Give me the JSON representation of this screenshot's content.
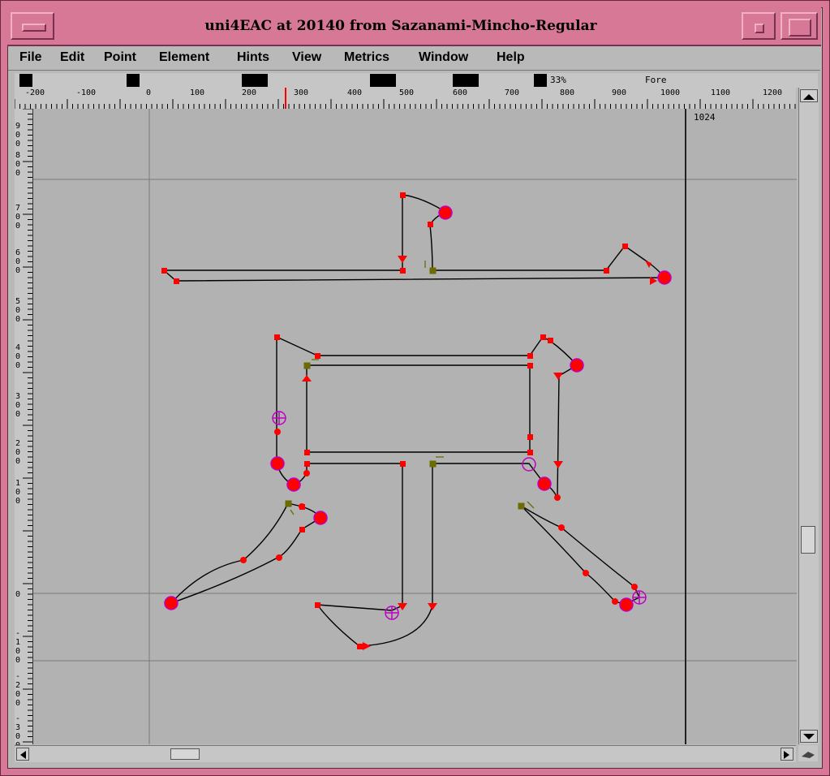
{
  "window": {
    "title": "uni4EAC at 20140 from Sazanami-Mincho-Regular"
  },
  "menu": [
    {
      "label": "File"
    },
    {
      "label": "Edit"
    },
    {
      "label": "Point"
    },
    {
      "label": "Element"
    },
    {
      "label": "Hints"
    },
    {
      "label": "View"
    },
    {
      "label": "Metrics"
    },
    {
      "label": "Window"
    },
    {
      "label": "Help"
    }
  ],
  "info_bar": {
    "zoom": "33%",
    "layer": "Fore"
  },
  "ruler": {
    "h_labels": [
      "-200",
      "-100",
      "0",
      "100",
      "200",
      "300",
      "400",
      "500",
      "600",
      "700",
      "800",
      "900",
      "1000",
      "1100",
      "1200"
    ],
    "v_labels": [
      "900",
      "800",
      "700",
      "600",
      "500",
      "400",
      "300",
      "200",
      "100",
      "0",
      "-100",
      "-200",
      "-300"
    ]
  },
  "canvas": {
    "advance_width_label": "1024"
  },
  "colors": {
    "frame": "#d67896",
    "canvas": "#b2b2b2",
    "point": "#ff0000",
    "extremum": "#c000c0",
    "start_point": "#6b6b00",
    "outline": "#000000",
    "guideline": "#7a7a7a"
  }
}
